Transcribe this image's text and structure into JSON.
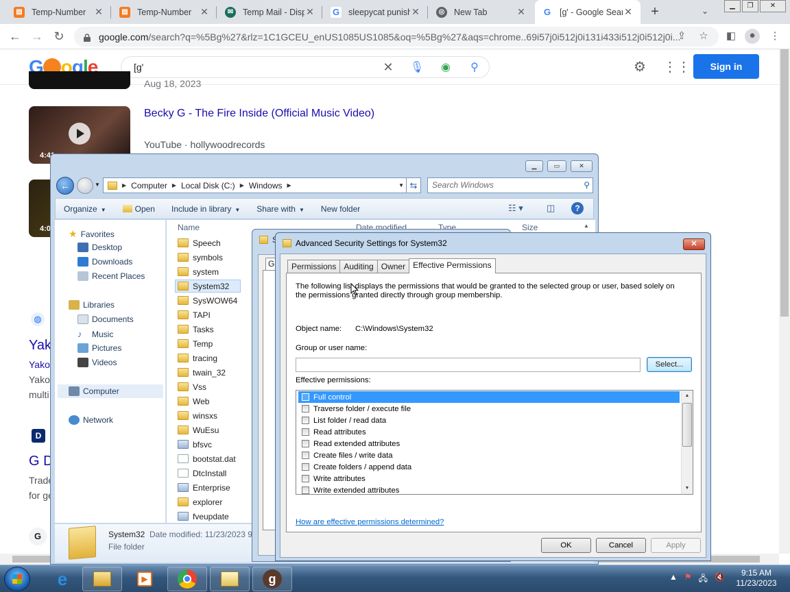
{
  "browser": {
    "tabs": [
      {
        "title": "Temp-Number",
        "favicon": "temp-number-icon",
        "color": "#f47b20"
      },
      {
        "title": "Temp-Number",
        "favicon": "temp-number-icon",
        "color": "#f47b20"
      },
      {
        "title": "Temp Mail - Disp",
        "favicon": "temp-mail-icon",
        "color": "#1b6e5a"
      },
      {
        "title": "sleepycat punish",
        "favicon": "google-icon",
        "color": "#4285f4"
      },
      {
        "title": "New Tab",
        "favicon": "chrome-icon",
        "color": "#5f6368"
      },
      {
        "title": "[g' - Google Sear",
        "favicon": "google-icon",
        "color": "#4285f4"
      }
    ],
    "url_host": "google.com",
    "url_rest": "/search?q=%5Bg%27&rlz=1C1GCEU_enUS1085US1085&oq=%5Bg%27&aqs=chrome..69i57j0i512j0i131i433i512j0i512j0i..."
  },
  "google": {
    "query": "[g'",
    "sign_in": "Sign in",
    "results": {
      "prev_date": "Aug 18, 2023",
      "video_title": "Becky G - The Fire Inside (Official Music Video)",
      "video_source": "YouTube",
      "video_channel": "hollywoodrecords",
      "video_duration": "4:41",
      "video2_duration": "4:0",
      "frag1_title": "Yak",
      "frag1_line1": "Yako",
      "frag1_line2": "Yako",
      "frag1_line3": "multi",
      "frag2_title": "G D",
      "frag2_line1": "Trade",
      "frag2_line2": "for ge",
      "frag3_badge": "G"
    }
  },
  "explorer": {
    "breadcrumb": [
      "Computer",
      "Local Disk (C:)",
      "Windows"
    ],
    "search_placeholder": "Search Windows",
    "commands": [
      "Organize",
      "Open",
      "Include in library",
      "Share with",
      "New folder"
    ],
    "nav": {
      "favorites": "Favorites",
      "favorites_items": [
        "Desktop",
        "Downloads",
        "Recent Places"
      ],
      "libraries": "Libraries",
      "libraries_items": [
        "Documents",
        "Music",
        "Pictures",
        "Videos"
      ],
      "computer": "Computer",
      "network": "Network"
    },
    "columns": {
      "name": "Name",
      "date": "Date modified",
      "type": "Type",
      "size": "Size"
    },
    "files": [
      {
        "name": "Speech",
        "kind": "folder"
      },
      {
        "name": "symbols",
        "kind": "folder"
      },
      {
        "name": "system",
        "kind": "folder"
      },
      {
        "name": "System32",
        "kind": "folder",
        "selected": true
      },
      {
        "name": "SysWOW64",
        "kind": "folder"
      },
      {
        "name": "TAPI",
        "kind": "folder"
      },
      {
        "name": "Tasks",
        "kind": "folder"
      },
      {
        "name": "Temp",
        "kind": "folder"
      },
      {
        "name": "tracing",
        "kind": "folder"
      },
      {
        "name": "twain_32",
        "kind": "folder"
      },
      {
        "name": "Vss",
        "kind": "folder"
      },
      {
        "name": "Web",
        "kind": "folder"
      },
      {
        "name": "winsxs",
        "kind": "folder"
      },
      {
        "name": "WuEsu",
        "kind": "folder"
      },
      {
        "name": "bfsvc",
        "kind": "exe"
      },
      {
        "name": "bootstat.dat",
        "kind": "doc"
      },
      {
        "name": "DtcInstall",
        "kind": "doc"
      },
      {
        "name": "Enterprise",
        "kind": "exe"
      },
      {
        "name": "explorer",
        "kind": "folder"
      },
      {
        "name": "fveupdate",
        "kind": "exe"
      }
    ],
    "details": {
      "name": "System32",
      "modified": "Date modified: 11/23/2023 9",
      "type": "File folder"
    }
  },
  "properties_window": {
    "title": "S",
    "tab_fragment": "Ge"
  },
  "advanced_security": {
    "title": "Advanced Security Settings for System32",
    "tabs": [
      "Permissions",
      "Auditing",
      "Owner",
      "Effective Permissions"
    ],
    "active_tab": "Effective Permissions",
    "description": "The following list displays the permissions that would be granted to the selected group or user, based solely on the permissions granted directly through group membership.",
    "object_name_label": "Object name:",
    "object_name_value": "C:\\Windows\\System32",
    "group_label": "Group or user name:",
    "group_value": "",
    "select_button": "Select...",
    "effective_label": "Effective permissions:",
    "permissions": [
      "Full control",
      "Traverse folder / execute file",
      "List folder / read data",
      "Read attributes",
      "Read extended attributes",
      "Create files / write data",
      "Create folders / append data",
      "Write attributes",
      "Write extended attributes"
    ],
    "selected_permission": "Full control",
    "help_link": "How are effective permissions determined?",
    "ok": "OK",
    "cancel": "Cancel",
    "apply": "Apply"
  },
  "taskbar": {
    "time": "9:15 AM",
    "date": "11/23/2023"
  },
  "colors": {
    "google_blue": "#1a73e8",
    "link": "#1a0dab",
    "selection": "#3399ff"
  }
}
